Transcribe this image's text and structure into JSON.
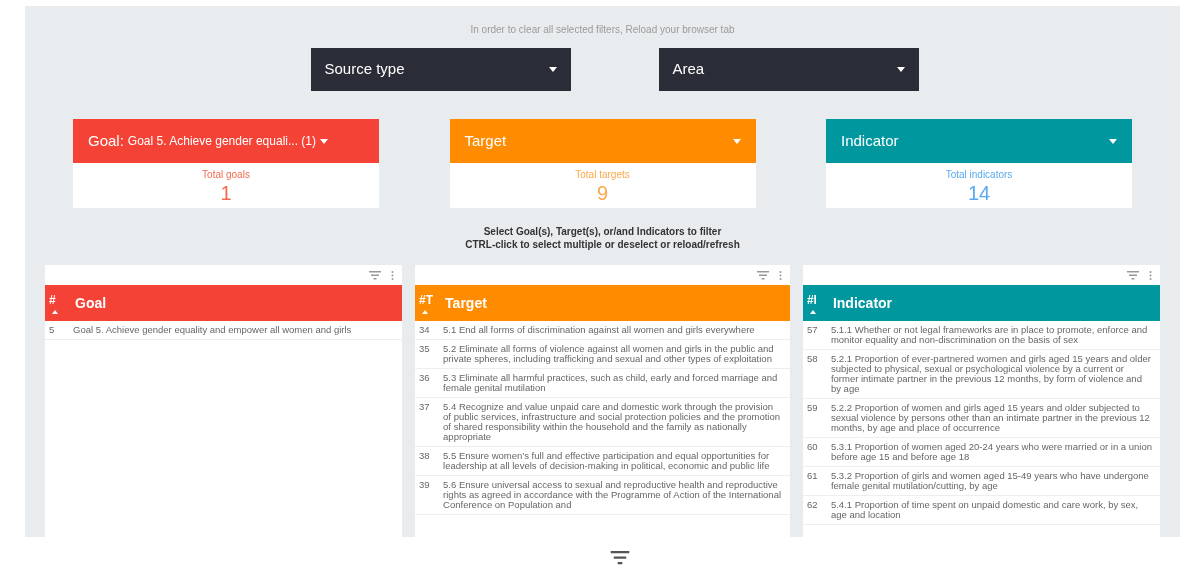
{
  "notice": "In order to clear all selected filters, Reload your browser tab",
  "dropdowns": [
    {
      "label": "Source type"
    },
    {
      "label": "Area"
    }
  ],
  "filter_cards": [
    {
      "label": "Goal:",
      "value": "Goal 5. Achieve gender equali... (1)",
      "color": "#f44336",
      "stat": {
        "label": "Total goals",
        "value": "1"
      }
    },
    {
      "label": "Target",
      "color": "#ff8c00",
      "stat": {
        "label": "Total targets",
        "value": "9"
      }
    },
    {
      "label": "Indicator",
      "color": "#00979f",
      "stat": {
        "label": "Total indicators",
        "value": "14"
      }
    }
  ],
  "instructions": [
    "Select Goal(s), Target(s), or/and Indicators to filter",
    "CTRL-click to select multiple or deselect or reload/refresh"
  ],
  "tables": [
    {
      "color": "#f44336",
      "columns": [
        "#",
        "Goal"
      ],
      "rows": [
        {
          "number": "5",
          "text": "Goal 5. Achieve gender equality and empower all women and girls"
        }
      ]
    },
    {
      "color": "#ff8c00",
      "columns": [
        "#T",
        "Target"
      ],
      "rows": [
        {
          "number": "34",
          "text": "5.1 End all forms of discrimination against all women and girls everywhere"
        },
        {
          "number": "35",
          "text": "5.2 Eliminate all forms of violence against all women and girls in the public and private spheres, including trafficking and sexual and other types of exploitation"
        },
        {
          "number": "36",
          "text": "5.3 Eliminate all harmful practices, such as child, early and forced marriage and female genital mutilation"
        },
        {
          "number": "37",
          "text": "5.4 Recognize and value unpaid care and domestic work through the provision of public services, infrastructure and social protection policies and the promotion of shared responsibility within the household and the family as nationally appropriate"
        },
        {
          "number": "38",
          "text": "5.5 Ensure women’s full and effective participation and equal opportunities for leadership at all levels of decision-making in political, economic and public life"
        },
        {
          "number": "39",
          "text": "5.6 Ensure universal access to sexual and reproductive health and reproductive rights as agreed in accordance with the Programme of Action of the International Conference on Population and"
        }
      ]
    },
    {
      "color": "#00979f",
      "columns": [
        "#I",
        "Indicator"
      ],
      "rows": [
        {
          "number": "57",
          "text": "5.1.1 Whether or not legal frameworks are in place to promote, enforce and monitor equality and non-discrimination on the basis of sex"
        },
        {
          "number": "58",
          "text": "5.2.1 Proportion of ever-partnered women and girls aged 15 years and older subjected to physical, sexual or psychological violence by a current or former intimate partner in the previous 12 months, by form of violence and by age"
        },
        {
          "number": "59",
          "text": "5.2.2 Proportion of women and girls aged 15 years and older subjected to sexual violence by persons other than an intimate partner in the previous 12 months, by age and place of occurrence"
        },
        {
          "number": "60",
          "text": "5.3.1 Proportion of women aged 20-24 years who were married or in a union before age 15 and before age 18"
        },
        {
          "number": "61",
          "text": "5.3.2 Proportion of girls and women aged 15-49 years who have undergone female genital mutilation/cutting, by age"
        },
        {
          "number": "62",
          "text": "5.4.1 Proportion of time spent on unpaid domestic and care work, by sex, age and location"
        }
      ]
    }
  ]
}
